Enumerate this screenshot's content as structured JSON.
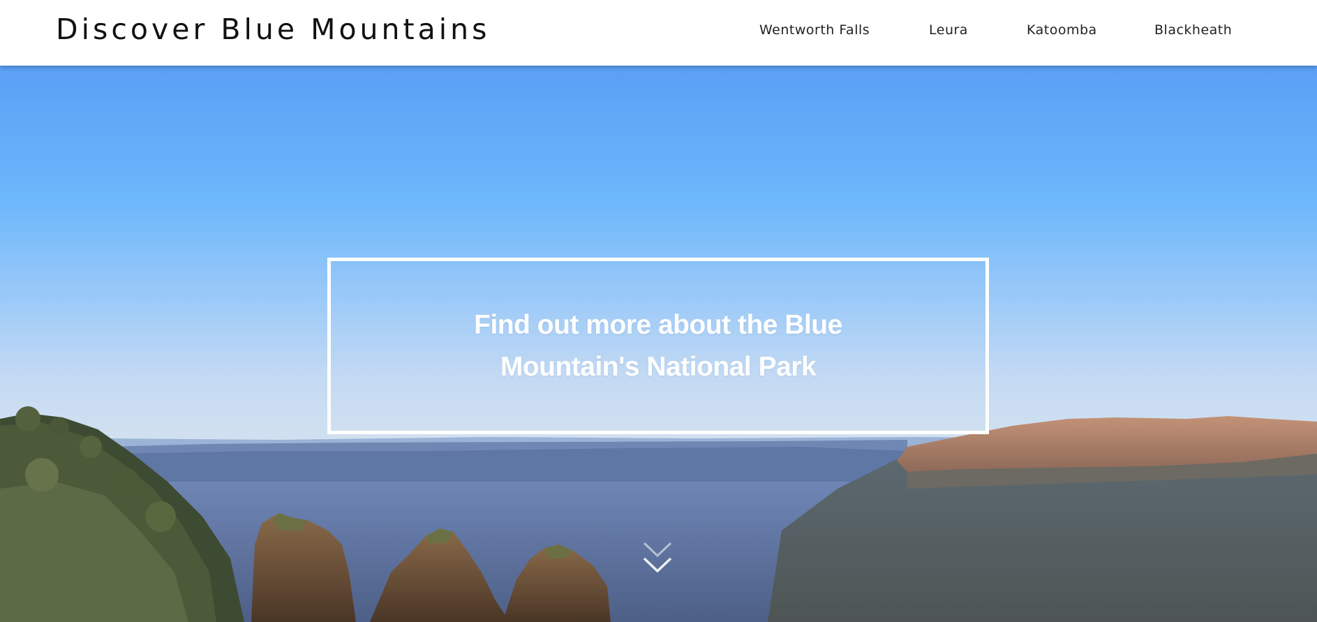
{
  "header": {
    "site_title": "Discover Blue Mountains",
    "nav": [
      {
        "label": "Wentworth Falls"
      },
      {
        "label": "Leura"
      },
      {
        "label": "Katoomba"
      },
      {
        "label": "Blackheath"
      }
    ]
  },
  "hero": {
    "heading": "Find out more about the Blue Mountain's National Park",
    "scroll_icon": "double-chevron-down-icon"
  },
  "colors": {
    "sky_top": "#5a9ff5",
    "sky_bottom": "#c4daf3",
    "cta_border": "#ffffff",
    "header_bg": "#ffffff"
  }
}
